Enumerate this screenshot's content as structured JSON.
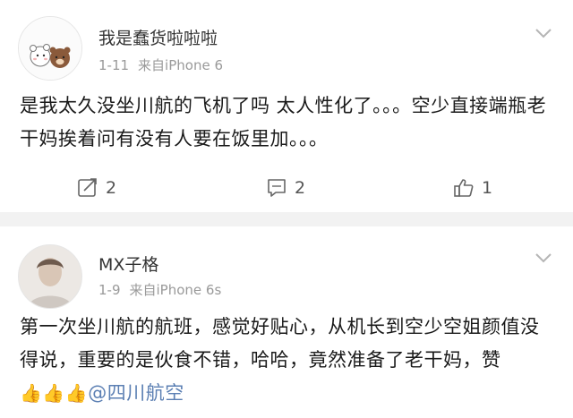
{
  "posts": [
    {
      "username": "我是蠢货啦啦啦",
      "date": "1-11",
      "source": "来自iPhone 6",
      "text": "是我太久没坐川航的飞机了吗 太人性化了。。。空少直接端瓶老干妈挨着问有没有人要在饭里加。。。",
      "actions": {
        "reposts": "2",
        "comments": "2",
        "likes": "1"
      },
      "icons": {
        "repost": "repost-icon",
        "comment": "comment-icon",
        "like": "thumbs-up-icon",
        "menu": "chevron-down-icon"
      }
    },
    {
      "username": "MX子格",
      "date": "1-9",
      "source": "来自iPhone 6s",
      "text": "第一次坐川航的航班，感觉好贴心，从机长到空少空姐颜值没得说，重要的是伙食不错，哈哈，竟然准备了老干妈，赞",
      "emoji": "👍👍👍",
      "mention": "@四川航空",
      "icons": {
        "menu": "chevron-down-icon"
      }
    }
  ],
  "colors": {
    "mention": "#5b7fb3",
    "meta": "#9a9a9a",
    "separator": "#f2f2f2"
  }
}
